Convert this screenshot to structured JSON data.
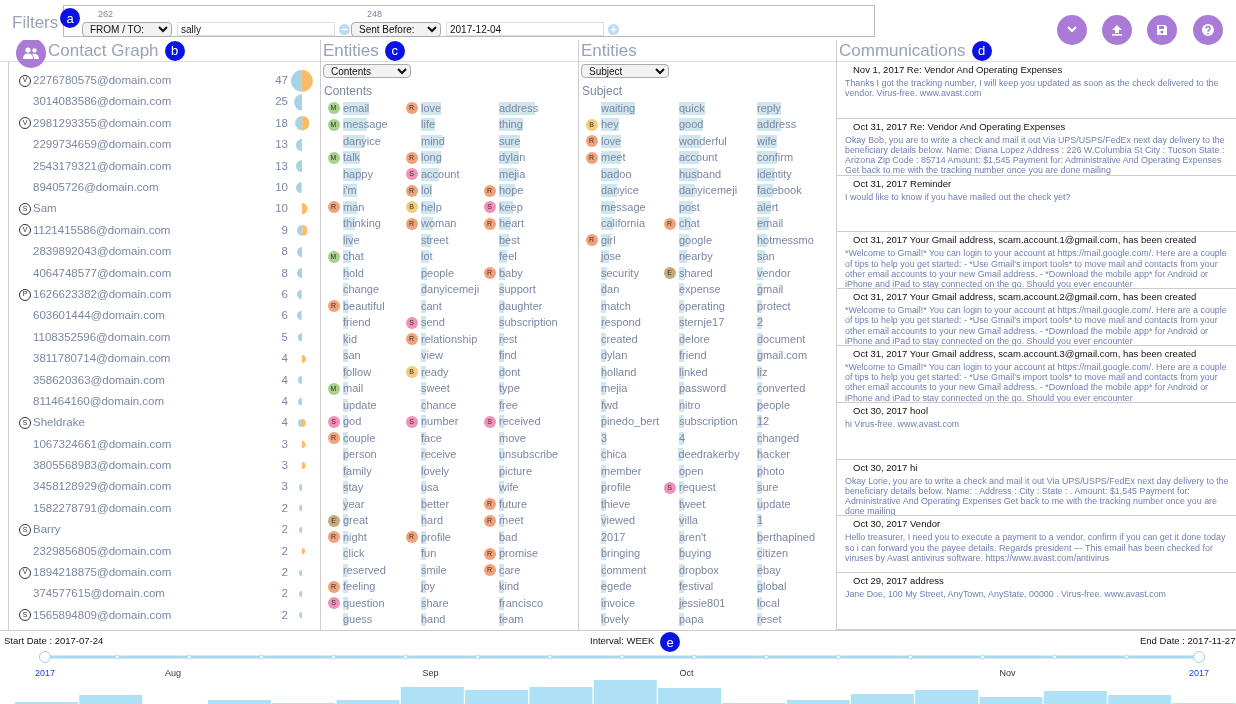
{
  "filters": {
    "label": "Filters",
    "badge": "a",
    "items": [
      {
        "count": "262",
        "field": "FROM / TO:",
        "value": "sally",
        "kind": "remove"
      },
      {
        "count": "248",
        "field": "Sent Before:",
        "value": "2017-12-04",
        "kind": "add"
      }
    ]
  },
  "contact_graph": {
    "title": "Contact Graph",
    "badge": "b",
    "contacts": [
      {
        "tag": "V",
        "address": "2276780575@domain.com",
        "count": "47",
        "kind": "both"
      },
      {
        "address": "3014083586@domain.com",
        "count": "25",
        "kind": "left"
      },
      {
        "tag": "V",
        "address": "2981293355@domain.com",
        "count": "18",
        "kind": "both"
      },
      {
        "address": "2299734659@domain.com",
        "count": "13",
        "kind": "left"
      },
      {
        "address": "2543179321@domain.com",
        "count": "13",
        "kind": "left"
      },
      {
        "address": "89405726@domain.com",
        "count": "10",
        "kind": "left"
      },
      {
        "tag": "S",
        "address": "Sam",
        "count": "10",
        "kind": "right"
      },
      {
        "tag": "V",
        "address": "1121415586@domain.com",
        "count": "9",
        "kind": "both"
      },
      {
        "address": "2839892043@domain.com",
        "count": "8",
        "kind": "left"
      },
      {
        "address": "4064748577@domain.com",
        "count": "8",
        "kind": "left"
      },
      {
        "tag": "P",
        "address": "1626623382@domain.com",
        "count": "6",
        "kind": "left"
      },
      {
        "address": "603601444@domain.com",
        "count": "6",
        "kind": "left"
      },
      {
        "address": "1108352596@domain.com",
        "count": "5",
        "kind": "left"
      },
      {
        "address": "3811780714@domain.com",
        "count": "4",
        "kind": "right"
      },
      {
        "address": "358620363@domain.com",
        "count": "4",
        "kind": "left"
      },
      {
        "address": "811464160@domain.com",
        "count": "4",
        "kind": "left"
      },
      {
        "tag": "S",
        "address": "Sheldrake",
        "count": "4",
        "kind": "both"
      },
      {
        "address": "1067324661@domain.com",
        "count": "3",
        "kind": "right"
      },
      {
        "address": "3805568983@domain.com",
        "count": "3",
        "kind": "right"
      },
      {
        "address": "3458128929@domain.com",
        "count": "3",
        "kind": "left"
      },
      {
        "address": "1582278791@domain.com",
        "count": "2",
        "kind": "left"
      },
      {
        "tag": "S",
        "address": "Barry",
        "count": "2",
        "kind": "left"
      },
      {
        "address": "2329856805@domain.com",
        "count": "2",
        "kind": "right"
      },
      {
        "tag": "V",
        "address": "1894218875@domain.com",
        "count": "2",
        "kind": "left"
      },
      {
        "address": "374577615@domain.com",
        "count": "2",
        "kind": "left"
      },
      {
        "tag": "S",
        "address": "1565894809@domain.com",
        "count": "2",
        "kind": "left"
      }
    ]
  },
  "entity_panels": [
    {
      "title": "Entities",
      "badge": "c",
      "dropdown": "Contents",
      "label": "Contents",
      "words": [
        {
          "text": "email",
          "tag": {
            "letter": "M",
            "color": "#a8d08c"
          }
        },
        {
          "text": "love",
          "tag": {
            "letter": "R",
            "color": "#f2a27a"
          }
        },
        {
          "text": "address"
        },
        {
          "text": "message",
          "tag": {
            "letter": "M",
            "color": "#a8d08c"
          }
        },
        {
          "text": "life"
        },
        {
          "text": "thing"
        },
        {
          "text": "danyice"
        },
        {
          "text": "mind"
        },
        {
          "text": "sure"
        },
        {
          "text": "talk",
          "tag": {
            "letter": "M",
            "color": "#a8d08c"
          }
        },
        {
          "text": "long",
          "tag": {
            "letter": "R",
            "color": "#f2a27a"
          }
        },
        {
          "text": "dylan"
        },
        {
          "text": "happy"
        },
        {
          "text": "account",
          "tag": {
            "letter": "S",
            "color": "#f48fb8"
          }
        },
        {
          "text": "mejia"
        },
        {
          "text": "i'm"
        },
        {
          "text": "lol",
          "tag": {
            "letter": "R",
            "color": "#f2a27a"
          }
        },
        {
          "text": "hope",
          "tag": {
            "letter": "R",
            "color": "#f2a27a"
          }
        },
        {
          "text": "man",
          "tag": {
            "letter": "R",
            "color": "#f2a27a"
          }
        },
        {
          "text": "help",
          "tag": {
            "letter": "B",
            "color": "#f5cc78"
          }
        },
        {
          "text": "keep",
          "tag": {
            "letter": "S",
            "color": "#f48fb8"
          }
        },
        {
          "text": "thinking"
        },
        {
          "text": "woman",
          "tag": {
            "letter": "R",
            "color": "#f2a27a"
          }
        },
        {
          "text": "heart",
          "tag": {
            "letter": "R",
            "color": "#f2a27a"
          }
        },
        {
          "text": "live"
        },
        {
          "text": "street"
        },
        {
          "text": "best"
        },
        {
          "text": "chat",
          "tag": {
            "letter": "M",
            "color": "#a8d08c"
          }
        },
        {
          "text": "lot"
        },
        {
          "text": "feel"
        },
        {
          "text": "hold"
        },
        {
          "text": "people"
        },
        {
          "text": "baby",
          "tag": {
            "letter": "R",
            "color": "#f2a27a"
          }
        },
        {
          "text": "change"
        },
        {
          "text": "danyicemeji"
        },
        {
          "text": "support"
        },
        {
          "text": "beautiful",
          "tag": {
            "letter": "R",
            "color": "#f2a27a"
          }
        },
        {
          "text": "cant"
        },
        {
          "text": "daughter"
        },
        {
          "text": "friend"
        },
        {
          "text": "send",
          "tag": {
            "letter": "S",
            "color": "#f48fb8"
          }
        },
        {
          "text": "subscription"
        },
        {
          "text": "kid"
        },
        {
          "text": "relationship",
          "tag": {
            "letter": "R",
            "color": "#f2a27a"
          }
        },
        {
          "text": "rest"
        },
        {
          "text": "san"
        },
        {
          "text": "view"
        },
        {
          "text": "find"
        },
        {
          "text": "follow"
        },
        {
          "text": "ready",
          "tag": {
            "letter": "B",
            "color": "#f5cc78"
          }
        },
        {
          "text": "dont"
        },
        {
          "text": "mail",
          "tag": {
            "letter": "M",
            "color": "#a8d08c"
          }
        },
        {
          "text": "sweet"
        },
        {
          "text": "type"
        },
        {
          "text": "update"
        },
        {
          "text": "chance"
        },
        {
          "text": "free"
        },
        {
          "text": "god",
          "tag": {
            "letter": "S",
            "color": "#f48fb8"
          }
        },
        {
          "text": "number",
          "tag": {
            "letter": "S",
            "color": "#f48fb8"
          }
        },
        {
          "text": "received",
          "tag": {
            "letter": "S",
            "color": "#f48fb8"
          }
        },
        {
          "text": "couple",
          "tag": {
            "letter": "R",
            "color": "#f2a27a"
          }
        },
        {
          "text": "face"
        },
        {
          "text": "move"
        },
        {
          "text": "person"
        },
        {
          "text": "receive"
        },
        {
          "text": "unsubscribe"
        },
        {
          "text": "family"
        },
        {
          "text": "lovely"
        },
        {
          "text": "picture"
        },
        {
          "text": "stay"
        },
        {
          "text": "usa"
        },
        {
          "text": "wife"
        },
        {
          "text": "year"
        },
        {
          "text": "better"
        },
        {
          "text": "future",
          "tag": {
            "letter": "R",
            "color": "#f2a27a"
          }
        },
        {
          "text": "great",
          "tag": {
            "letter": "E",
            "color": "#c9a97a"
          }
        },
        {
          "text": "hard"
        },
        {
          "text": "meet",
          "tag": {
            "letter": "R",
            "color": "#f2a27a"
          }
        },
        {
          "text": "night",
          "tag": {
            "letter": "R",
            "color": "#f2a27a"
          }
        },
        {
          "text": "profile",
          "tag": {
            "letter": "R",
            "color": "#f2a27a"
          }
        },
        {
          "text": "bad"
        },
        {
          "text": "click"
        },
        {
          "text": "fun"
        },
        {
          "text": "promise",
          "tag": {
            "letter": "R",
            "color": "#f2a27a"
          }
        },
        {
          "text": "reserved"
        },
        {
          "text": "smile"
        },
        {
          "text": "care",
          "tag": {
            "letter": "R",
            "color": "#f2a27a"
          }
        },
        {
          "text": "feeling",
          "tag": {
            "letter": "R",
            "color": "#f2a27a"
          }
        },
        {
          "text": "joy"
        },
        {
          "text": "kind"
        },
        {
          "text": "question",
          "tag": {
            "letter": "S",
            "color": "#f48fb8"
          }
        },
        {
          "text": "share"
        },
        {
          "text": "francisco"
        },
        {
          "text": "guess"
        },
        {
          "text": "hand"
        },
        {
          "text": "team"
        }
      ]
    },
    {
      "title": "Entities",
      "dropdown": "Subject",
      "label": "Subject",
      "words": [
        {
          "text": "waiting"
        },
        {
          "text": "quick"
        },
        {
          "text": "reply"
        },
        {
          "text": "hey",
          "tag": {
            "letter": "B",
            "color": "#f5cc78"
          }
        },
        {
          "text": "good"
        },
        {
          "text": "address"
        },
        {
          "text": "love",
          "tag": {
            "letter": "R",
            "color": "#f2a27a"
          }
        },
        {
          "text": "wonderful"
        },
        {
          "text": "wife"
        },
        {
          "text": "meet",
          "tag": {
            "letter": "R",
            "color": "#f2a27a"
          }
        },
        {
          "text": "account"
        },
        {
          "text": "confirm"
        },
        {
          "text": "badoo"
        },
        {
          "text": "husband"
        },
        {
          "text": "identity"
        },
        {
          "text": "danyice"
        },
        {
          "text": "danyicemeji"
        },
        {
          "text": "facebook"
        },
        {
          "text": "message"
        },
        {
          "text": "post"
        },
        {
          "text": "alert"
        },
        {
          "text": "california"
        },
        {
          "text": "chat",
          "tag": {
            "letter": "R",
            "color": "#f2a27a"
          }
        },
        {
          "text": "email"
        },
        {
          "text": "girl",
          "tag": {
            "letter": "R",
            "color": "#f2a27a"
          }
        },
        {
          "text": "google"
        },
        {
          "text": "hotmessmo"
        },
        {
          "text": "jose"
        },
        {
          "text": "nearby"
        },
        {
          "text": "san"
        },
        {
          "text": "security"
        },
        {
          "text": "shared",
          "tag": {
            "letter": "E",
            "color": "#c9a97a"
          }
        },
        {
          "text": "vendor"
        },
        {
          "text": "dan"
        },
        {
          "text": "expense"
        },
        {
          "text": "gmail"
        },
        {
          "text": "match"
        },
        {
          "text": "operating"
        },
        {
          "text": "protect"
        },
        {
          "text": "respond"
        },
        {
          "text": "sternje17"
        },
        {
          "text": "2"
        },
        {
          "text": "created"
        },
        {
          "text": "delore"
        },
        {
          "text": "document"
        },
        {
          "text": "dylan"
        },
        {
          "text": "friend"
        },
        {
          "text": "gmail.com"
        },
        {
          "text": "holland"
        },
        {
          "text": "linked"
        },
        {
          "text": "liz"
        },
        {
          "text": "mejia"
        },
        {
          "text": "password"
        },
        {
          "text": "converted"
        },
        {
          "text": "fwd"
        },
        {
          "text": "nitro"
        },
        {
          "text": "people"
        },
        {
          "text": "pinedo_bert"
        },
        {
          "text": "subscription"
        },
        {
          "text": "12"
        },
        {
          "text": "3"
        },
        {
          "text": "4"
        },
        {
          "text": "changed"
        },
        {
          "text": "chica"
        },
        {
          "text": "deedrakerby"
        },
        {
          "text": "hacker"
        },
        {
          "text": "member"
        },
        {
          "text": "open"
        },
        {
          "text": "photo"
        },
        {
          "text": "profile"
        },
        {
          "text": "request",
          "tag": {
            "letter": "S",
            "color": "#f48fb8"
          }
        },
        {
          "text": "sure"
        },
        {
          "text": "thieve"
        },
        {
          "text": "tweet"
        },
        {
          "text": "update"
        },
        {
          "text": "viewed"
        },
        {
          "text": "villa"
        },
        {
          "text": "1"
        },
        {
          "text": "2017"
        },
        {
          "text": "aren't"
        },
        {
          "text": "berthapined"
        },
        {
          "text": "bringing"
        },
        {
          "text": "buying"
        },
        {
          "text": "citizen"
        },
        {
          "text": "comment"
        },
        {
          "text": "dropbox"
        },
        {
          "text": "ebay"
        },
        {
          "text": "egede"
        },
        {
          "text": "festival"
        },
        {
          "text": "global"
        },
        {
          "text": "invoice"
        },
        {
          "text": "jessie801"
        },
        {
          "text": "local"
        },
        {
          "text": "lovely"
        },
        {
          "text": "papa"
        },
        {
          "text": "reset"
        }
      ]
    }
  ],
  "communications": {
    "title": "Communications",
    "badge": "d",
    "messages": [
      {
        "heading": "Nov 1, 2017 Re: Vendor And Operating Expenses",
        "body": "Thanks I got the tracking number, I will keep you updated as soon as the check delivered to the vendor. Virus-free. www.avast.com"
      },
      {
        "heading": "Oct 31, 2017 Re: Vendor And Operating Expenses",
        "body": "Okay Bob, you are to write a check and mail it out Via UPS/USPS/FedEx next day delivery to the beneficiary details below. Name: Diana Lopez Address : 226 W.Columbia St City : Tucson State : Arizona Zip Code : 85714 Amount: $1,545 Payment for: Administrative And Operating Expenses Get back to me with the tracking number once you are done mailing"
      },
      {
        "heading": "Oct 31, 2017 Reminder",
        "body": "I would like to know if you have mailed out the check yet?"
      },
      {
        "heading": "Oct 31, 2017 Your Gmail address, scam.account.1@gmail.com, has been created",
        "body": "*Welcome to Gmail!* You can login to your account at https://mail.google.com/. Here are a couple of tips to help you get started: - *Use Gmail's import tools* to move mail and contacts from your other email accounts to your new Gmail address. - *Download the mobile app* for Android or iPhone and iPad to stay connected on the go. Should you ever encounter"
      },
      {
        "heading": "Oct 31, 2017 Your Gmail address, scam.account.2@gmail.com, has been created",
        "body": "*Welcome to Gmail!* You can login to your account at https://mail.google.com/. Here are a couple of tips to help you get started: - *Use Gmail's import tools* to move mail and contacts from your other email accounts to your new Gmail address. - *Download the mobile app* for Android or iPhone and iPad to stay connected on the go. Should you ever encounter"
      },
      {
        "heading": "Oct 31, 2017 Your Gmail address, scam.account.3@gmail.com, has been created",
        "body": "*Welcome to Gmail!* You can login to your account at https://mail.google.com/. Here are a couple of tips to help you get started: - *Use Gmail's import tools* to move mail and contacts from your other email accounts to your new Gmail address. - *Download the mobile app* for Android or iPhone and iPad to stay connected on the go. Should you ever encounter"
      },
      {
        "heading": "Oct 30, 2017 hool",
        "body": "hi Virus-free. www.avast.com"
      },
      {
        "heading": "Oct 30, 2017 hi",
        "body": "Okay Lorie, you are to write a check and mail it out Via UPS/USPS/FedEx next day delivery to the beneficiary details below. Name: : Address : City : State : . Amount: $1,545 Payment for: Administrative And Operating Expenses Get back to me with the tracking number once you are done mailing"
      },
      {
        "heading": "Oct 30, 2017 Vendor",
        "body": "Hello treasurer, I need you to execute a payment to a vendor, confirm if you can get it done today so i can forward you the payee details. Regards president --- This email has been checked for viruses by Avast antivirus software. https://www.avast.com/antivirus"
      },
      {
        "heading": "Oct 29, 2017 address",
        "body": "Jane Doe, 100 My Street, AnyTown, AnyState, 00000 . Virus-free. www.avast.com"
      }
    ]
  },
  "timeline": {
    "start": "Start Date : 2017-07-24",
    "interval": "Interval: WEEK",
    "badge": "e",
    "end": "End Date : 2017-11-27",
    "ticks": [
      {
        "label": "2017",
        "kind": "year"
      },
      {
        "label": "Aug",
        "kind": "month"
      },
      {
        "label": "Sep",
        "kind": "month"
      },
      {
        "label": "Oct",
        "kind": "month"
      },
      {
        "label": "Nov",
        "kind": "month"
      },
      {
        "label": "2017",
        "kind": "year"
      }
    ]
  }
}
